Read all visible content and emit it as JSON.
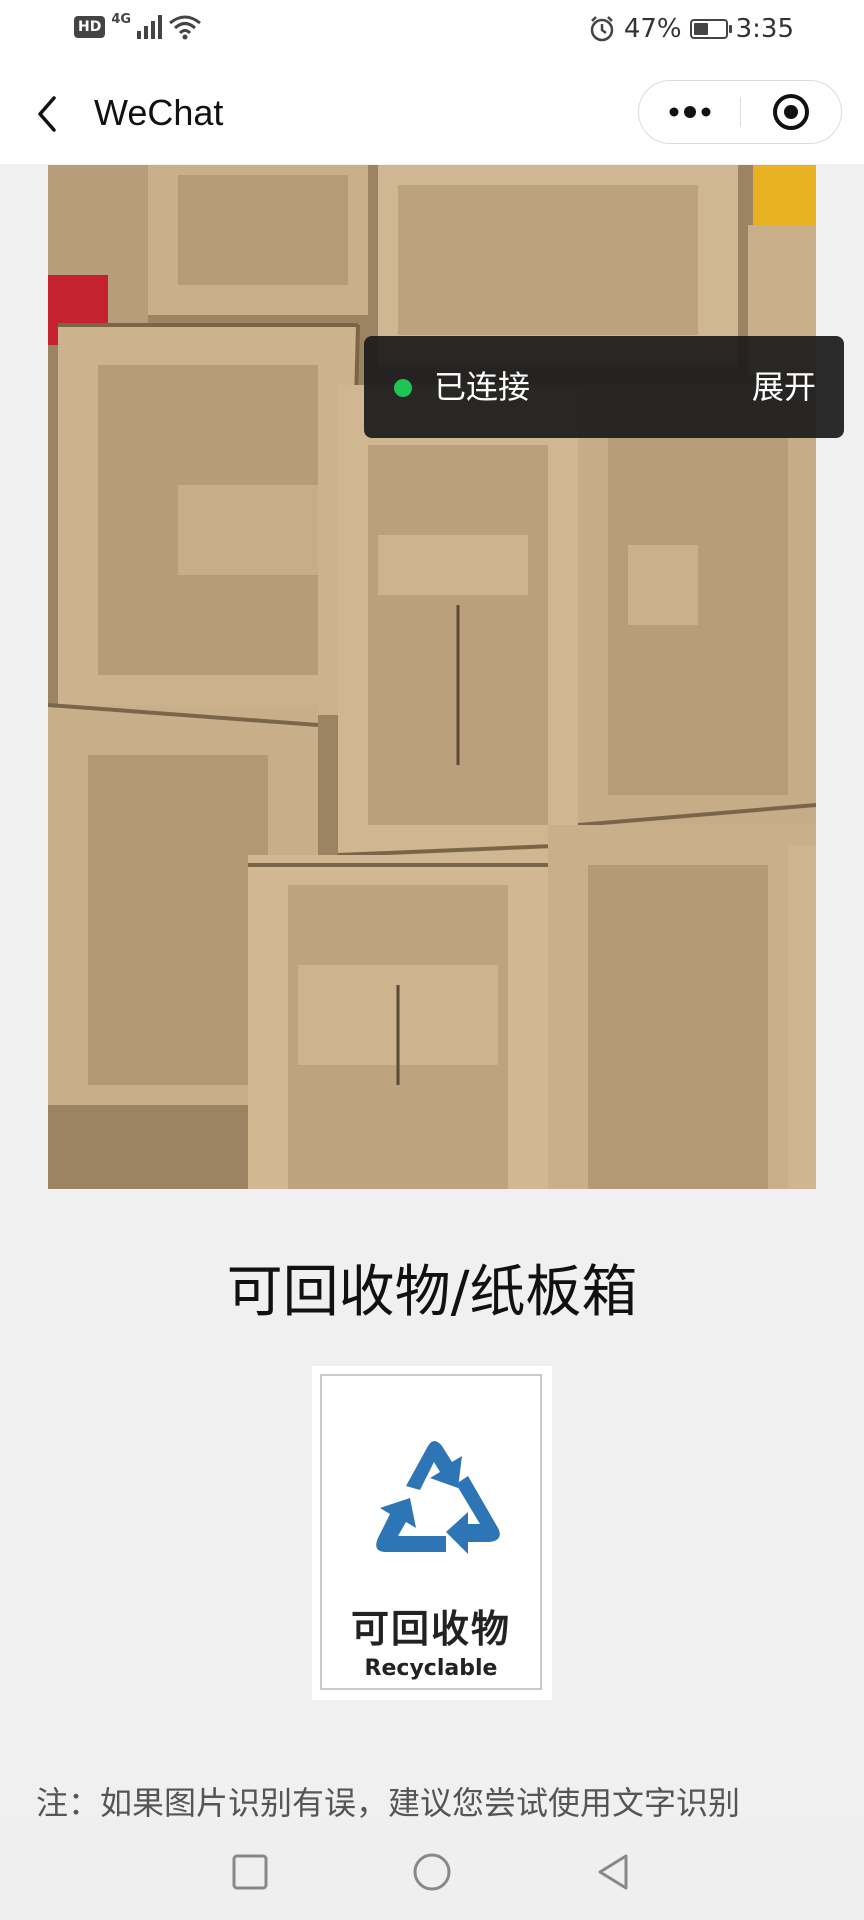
{
  "status_bar": {
    "hd_label": "HD",
    "network_label": "4G",
    "battery_percent": "47%",
    "battery_level": 0.47,
    "time": "3:35",
    "icons": [
      "signal-icon",
      "wifi-icon",
      "alarm-icon",
      "battery-icon"
    ]
  },
  "nav": {
    "back_icon": "chevron-left-icon",
    "title": "WeChat",
    "more_icon": "more-dots-icon",
    "close_icon": "target-close-icon"
  },
  "toast": {
    "status_text": "已连接",
    "expand_label": "展开",
    "dot_color": "#1ec456"
  },
  "result": {
    "title": "可回收物/纸板箱",
    "sign": {
      "cn_label": "可回收物",
      "en_label": "Recyclable",
      "icon": "recycle-icon",
      "color": "#2e75b6"
    }
  },
  "note": {
    "text": "注：如果图片识别有误，建议您尝试使用文字识别"
  },
  "system_nav": {
    "icons": [
      "recent-apps-square-icon",
      "home-circle-icon",
      "back-triangle-icon"
    ]
  }
}
